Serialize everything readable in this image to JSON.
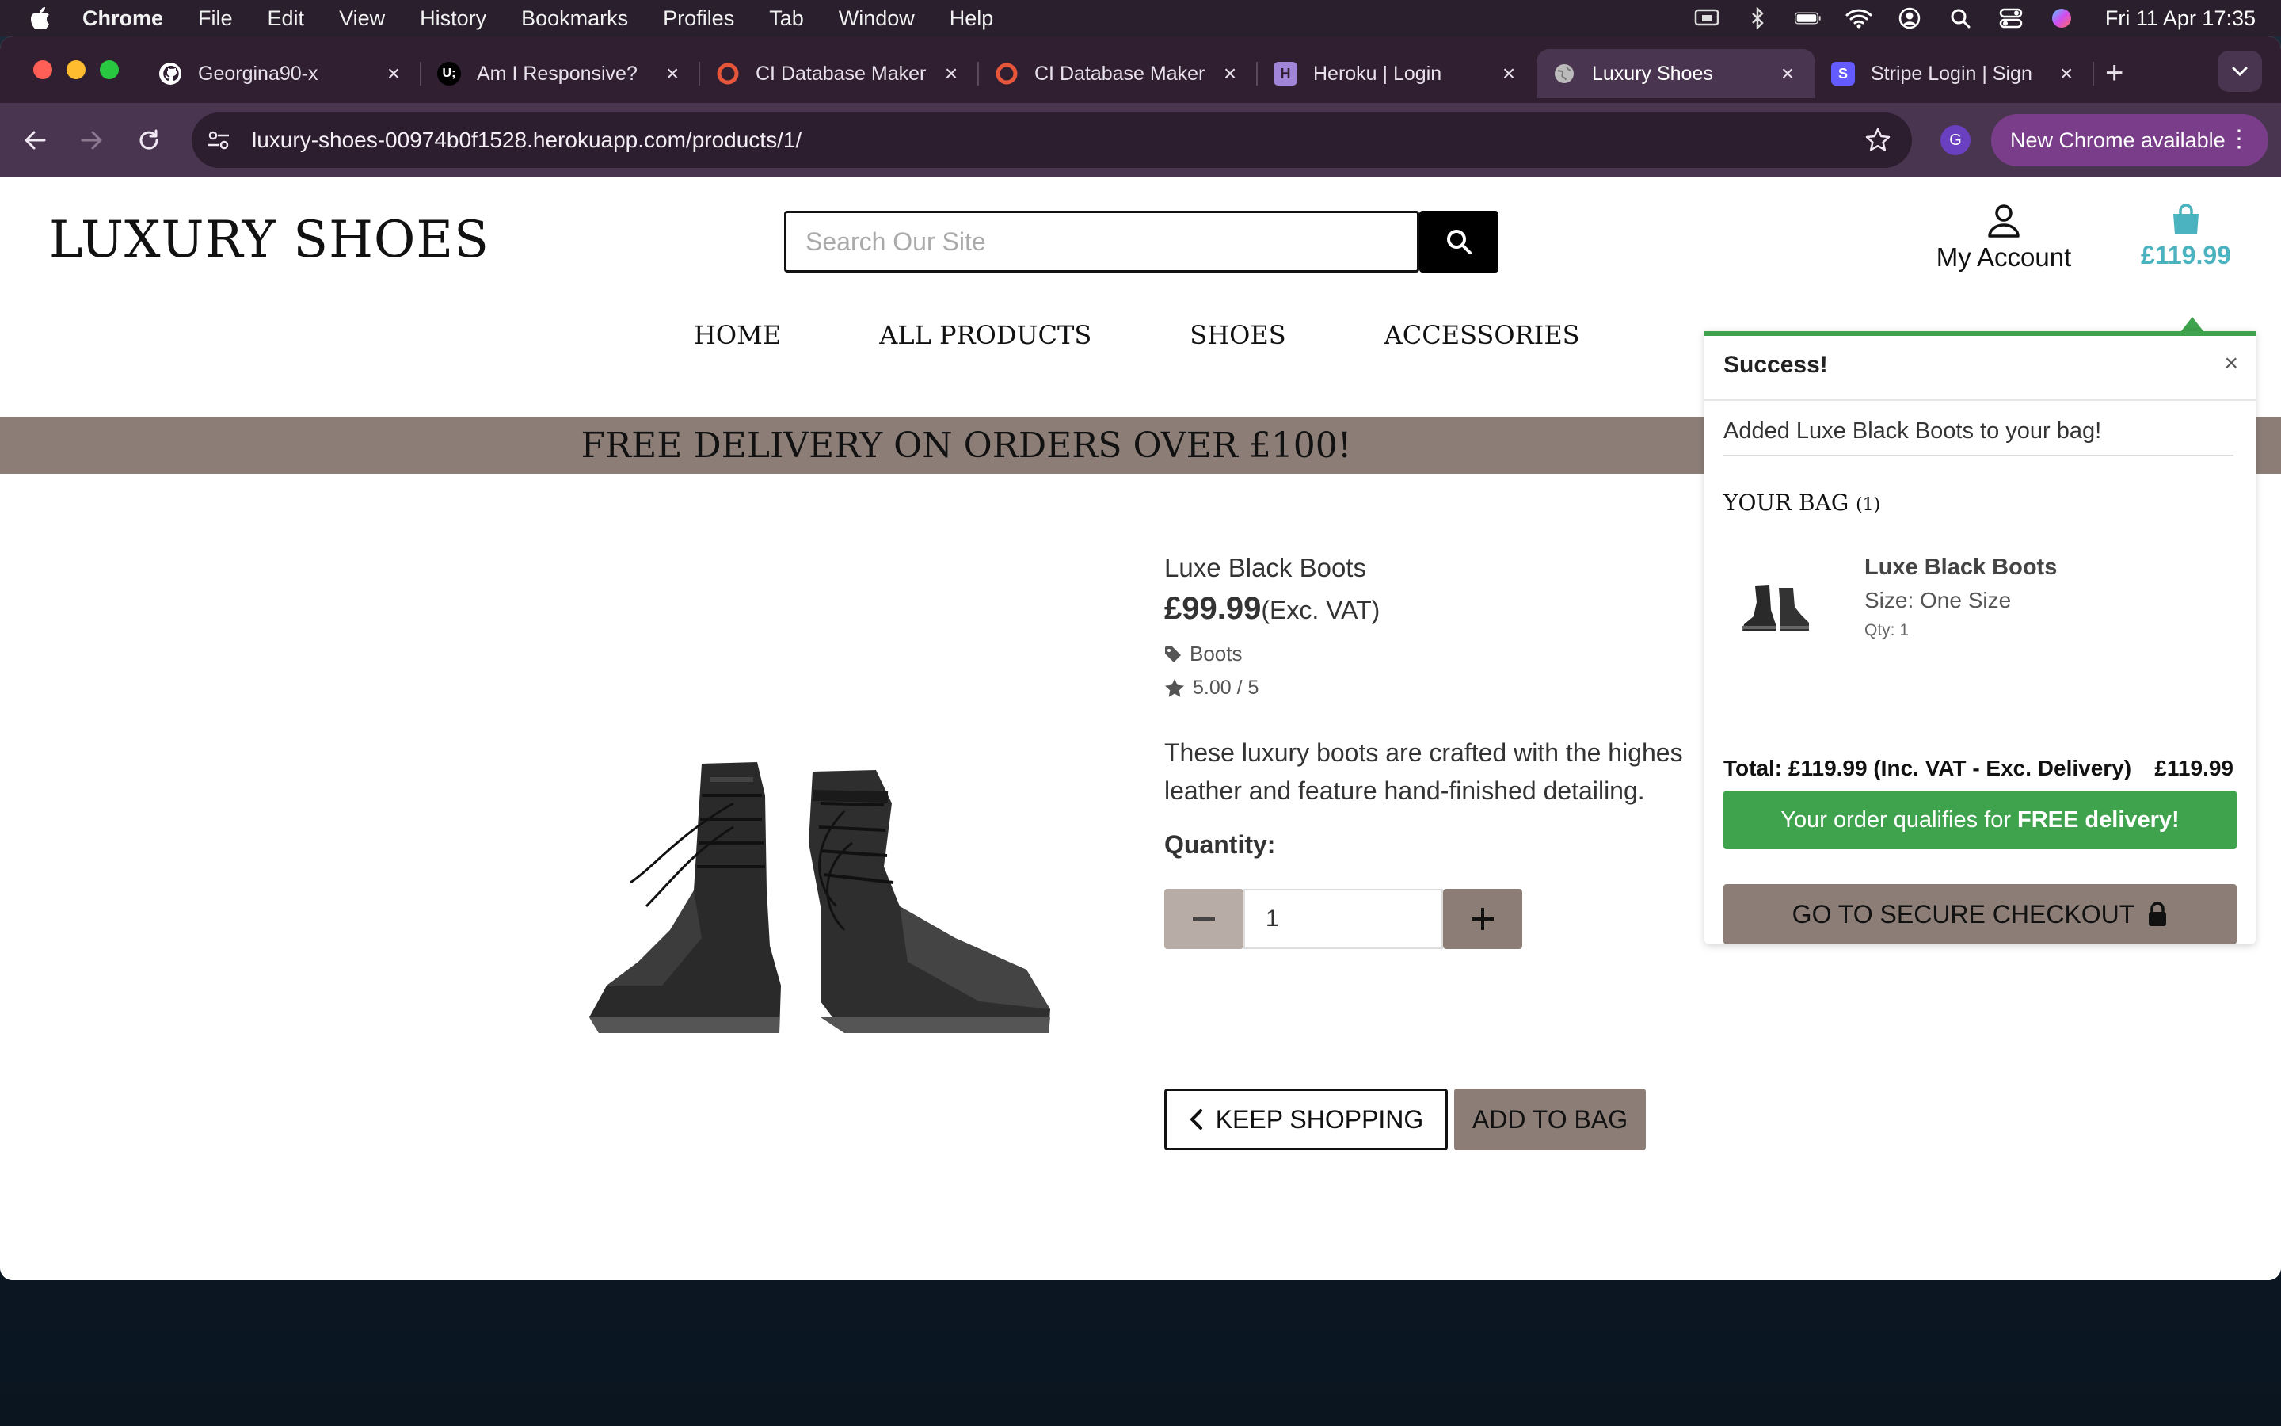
{
  "menubar": {
    "app": "Chrome",
    "items": [
      "File",
      "Edit",
      "View",
      "History",
      "Bookmarks",
      "Profiles",
      "Tab",
      "Window",
      "Help"
    ],
    "clock": "Fri 11 Apr  17:35"
  },
  "tabs": [
    {
      "title": "Georgina90-x",
      "icon": "github-icon",
      "active": false
    },
    {
      "title": "Am I Responsive?",
      "icon": "ui-icon",
      "active": false
    },
    {
      "title": "CI Database Maker",
      "icon": "ci-icon",
      "active": false
    },
    {
      "title": "CI Database Maker",
      "icon": "ci-icon",
      "active": false
    },
    {
      "title": "Heroku | Login",
      "icon": "heroku-icon",
      "active": false
    },
    {
      "title": "Luxury Shoes",
      "icon": "globe-icon",
      "active": true
    },
    {
      "title": "Stripe Login | Sign",
      "icon": "stripe-icon",
      "active": false
    }
  ],
  "toolbar": {
    "url": "luxury-shoes-00974b0f1528.herokuapp.com/products/1/",
    "profile_initial": "G",
    "update_label": "New Chrome available"
  },
  "site": {
    "logo": "LUXURY SHOES",
    "search_placeholder": "Search Our Site",
    "account_label": "My Account",
    "bag_total": "£119.99",
    "nav": [
      "HOME",
      "ALL PRODUCTS",
      "SHOES",
      "ACCESSORIES"
    ],
    "banner": "FREE DELIVERY ON ORDERS OVER £100!"
  },
  "product": {
    "name": "Luxe Black Boots",
    "price": "£99.99",
    "price_note": "(Exc. VAT)",
    "category": "Boots",
    "rating": "5.00 / 5",
    "description": "These luxury boots are crafted with the highes leather and feature hand-finished detailing.",
    "quantity_label": "Quantity:",
    "quantity": "1",
    "keep_shopping": "KEEP SHOPPING",
    "add_to_bag": "ADD TO BAG"
  },
  "toast": {
    "title": "Success!",
    "close": "×",
    "message": "Added Luxe Black Boots to your bag!",
    "bag_heading": "YOUR BAG",
    "bag_count": "(1)",
    "item_name": "Luxe Black Boots",
    "item_size": "Size: One Size",
    "item_qty": "Qty: 1",
    "total_label": "Total: £119.99 (Inc. VAT - Exc. Delivery)",
    "total_value": "£119.99",
    "free_delivery_prefix": "Your order qualifies for",
    "free_delivery_bold": "FREE delivery!",
    "checkout": "GO TO SECURE CHECKOUT"
  },
  "colors": {
    "brand_taupe": "#8c7e77",
    "success_green": "#3fa34d",
    "bag_teal": "#4bb3c0",
    "chrome_frame": "#4a3550"
  }
}
